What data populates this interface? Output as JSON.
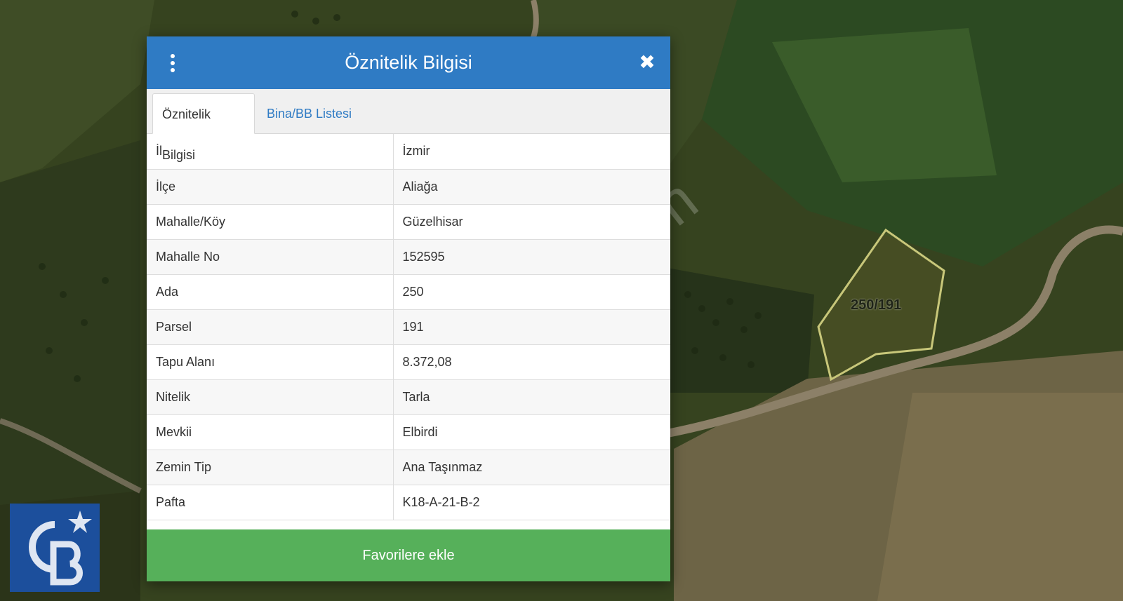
{
  "dialog": {
    "title": "Öznitelik Bilgisi",
    "close_icon": "close-icon",
    "menu_icon": "vertical-dots-icon",
    "tabs": [
      {
        "label": "Öznitelik Bilgisi",
        "active": true
      },
      {
        "label": "Bina/BB Listesi",
        "active": false
      }
    ],
    "rows": [
      {
        "key": "İl",
        "value": "İzmir"
      },
      {
        "key": "İlçe",
        "value": "Aliağa"
      },
      {
        "key": "Mahalle/Köy",
        "value": "Güzelhisar"
      },
      {
        "key": "Mahalle No",
        "value": "152595"
      },
      {
        "key": "Ada",
        "value": "250"
      },
      {
        "key": "Parsel",
        "value": "191"
      },
      {
        "key": "Tapu Alanı",
        "value": "8.372,08"
      },
      {
        "key": "Nitelik",
        "value": "Tarla"
      },
      {
        "key": "Mevkii",
        "value": "Elbirdi"
      },
      {
        "key": "Zemin Tip",
        "value": "Ana Taşınmaz"
      },
      {
        "key": "Pafta",
        "value": "K18-A-21-B-2"
      }
    ],
    "favorite_button": "Favorilere ekle"
  },
  "map": {
    "parcel_label": "250/191",
    "watermark": "emlakjet.com"
  },
  "colors": {
    "header": "#2f7bc4",
    "favorite_button": "#56b05a",
    "tab_link": "#2f7bc4",
    "parcel_outline": "#c8c77a",
    "logo_background": "#1c4f9c"
  }
}
